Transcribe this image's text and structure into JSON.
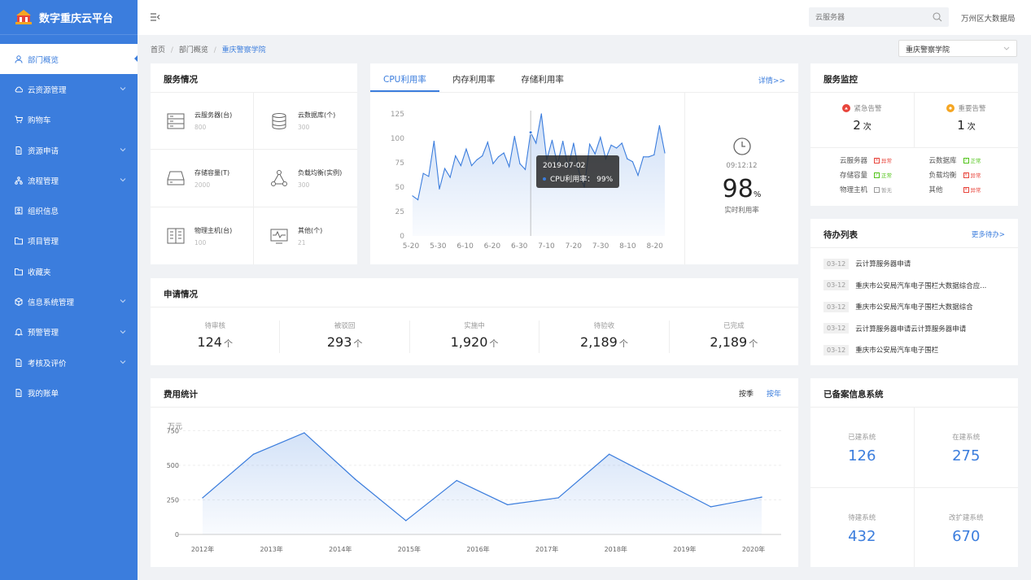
{
  "app": {
    "title": "数字重庆云平台"
  },
  "sidebar": {
    "items": [
      {
        "label": "部门概览",
        "icon": "user-icon",
        "active": true
      },
      {
        "label": "云资源管理",
        "icon": "cloud-icon",
        "expandable": true
      },
      {
        "label": "购物车",
        "icon": "cart-icon"
      },
      {
        "label": "资源申请",
        "icon": "document-icon",
        "expandable": true
      },
      {
        "label": "流程管理",
        "icon": "flow-icon",
        "expandable": true
      },
      {
        "label": "组织信息",
        "icon": "id-card-icon"
      },
      {
        "label": "项目管理",
        "icon": "folder-icon"
      },
      {
        "label": "收藏夹",
        "icon": "folder-icon"
      },
      {
        "label": "信息系统管理",
        "icon": "cube-icon",
        "expandable": true
      },
      {
        "label": "预警管理",
        "icon": "bell-icon",
        "expandable": true
      },
      {
        "label": "考核及评价",
        "icon": "document-icon",
        "expandable": true
      },
      {
        "label": "我的账单",
        "icon": "document-icon"
      }
    ]
  },
  "header": {
    "search_placeholder": "云服务器",
    "user": "万州区大数据局"
  },
  "breadcrumb": {
    "items": [
      "首页",
      "部门概览"
    ],
    "current": "重庆警察学院",
    "separator": "/"
  },
  "dept_select": {
    "value": "重庆警察学院"
  },
  "service_status": {
    "title": "服务情况",
    "items": [
      {
        "label": "云服务器(台)",
        "value": "800",
        "icon": "server-icon"
      },
      {
        "label": "云数据库(个)",
        "value": "300",
        "icon": "database-icon"
      },
      {
        "label": "存储容量(T)",
        "value": "2000",
        "icon": "storage-icon"
      },
      {
        "label": "负载均衡(实例)",
        "value": "300",
        "icon": "load-balancer-icon"
      },
      {
        "label": "物理主机(台)",
        "value": "100",
        "icon": "physical-host-icon"
      },
      {
        "label": "其他(个)",
        "value": "21",
        "icon": "monitor-icon"
      }
    ]
  },
  "utilization": {
    "tabs": [
      "CPU利用率",
      "内存利用率",
      "存储利用率"
    ],
    "active_tab": 0,
    "details_link": "详情>>",
    "tooltip_date": "2019-07-02",
    "tooltip_label": "CPU利用率：",
    "tooltip_value": "99%",
    "time": "09:12:12",
    "realtime_value": "98",
    "realtime_unit": "%",
    "realtime_label": "实时利用率"
  },
  "applications": {
    "title": "申请情况",
    "items": [
      {
        "label": "待审核",
        "value": "124"
      },
      {
        "label": "被驳回",
        "value": "293"
      },
      {
        "label": "实施中",
        "value": "1,920"
      },
      {
        "label": "待验收",
        "value": "2,189"
      },
      {
        "label": "已完成",
        "value": "2,189"
      }
    ],
    "trend_glyph": "个"
  },
  "cost": {
    "title": "费用统计",
    "toggle": [
      "按季",
      "按年"
    ],
    "active_toggle": 1,
    "unit": "万元"
  },
  "monitoring": {
    "title": "服务监控",
    "alerts": [
      {
        "label": "紧急告警",
        "value": "2",
        "unit": "次",
        "color": "#e8453c"
      },
      {
        "label": "重要告警",
        "value": "1",
        "unit": "次",
        "color": "#f5a623"
      }
    ],
    "items": [
      {
        "name": "云服务器",
        "status": "异常",
        "color": "#e8453c"
      },
      {
        "name": "云数据库",
        "status": "正常",
        "color": "#52c41a"
      },
      {
        "name": "存储容量",
        "status": "正常",
        "color": "#52c41a"
      },
      {
        "name": "负载均衡",
        "status": "异常",
        "color": "#e8453c"
      },
      {
        "name": "物理主机",
        "status": "暂无",
        "color": "#999999"
      },
      {
        "name": "其他",
        "status": "异常",
        "color": "#e8453c"
      }
    ]
  },
  "todo": {
    "title": "待办列表",
    "more": "更多待办>",
    "items": [
      {
        "date": "03-12",
        "text": "云计算服务器申请"
      },
      {
        "date": "03-12",
        "text": "重庆市公安局汽车电子围栏大数据综合应..."
      },
      {
        "date": "03-12",
        "text": "重庆市公安局汽车电子围栏大数据综合"
      },
      {
        "date": "03-12",
        "text": "云计算服务器申请云计算服务器申请"
      },
      {
        "date": "03-12",
        "text": "重庆市公安局汽车电子围栏"
      }
    ]
  },
  "systems": {
    "title": "已备案信息系统",
    "items": [
      {
        "label": "已建系统",
        "value": "126"
      },
      {
        "label": "在建系统",
        "value": "275"
      },
      {
        "label": "待建系统",
        "value": "432"
      },
      {
        "label": "改扩建系统",
        "value": "670"
      }
    ]
  },
  "colors": {
    "accent": "#3b7ddd",
    "sidebar": "#3b7ddd",
    "danger": "#e8453c",
    "warning": "#f5a623",
    "success": "#52c41a"
  },
  "chart_data": [
    {
      "type": "area",
      "title": "CPU利用率",
      "categories": [
        "5-20",
        "5-30",
        "6-10",
        "6-20",
        "6-30",
        "7-10",
        "7-20",
        "7-30",
        "8-10",
        "8-20"
      ],
      "yticks": [
        0,
        25,
        50,
        75,
        100,
        125
      ],
      "ylim": [
        0,
        125
      ],
      "xlim": [
        0,
        48
      ],
      "series": [
        {
          "values": [
            41,
            37,
            64,
            61,
            97,
            48,
            69,
            60,
            82,
            72,
            89,
            72,
            78,
            82,
            96,
            74,
            81,
            85,
            71,
            102,
            74,
            68,
            106,
            95,
            125,
            78,
            98,
            73,
            97,
            70,
            95,
            66,
            50,
            94,
            84,
            101,
            79,
            93,
            90,
            95,
            79,
            76,
            62,
            81,
            81,
            83,
            113,
            85
          ]
        }
      ],
      "highlight_index": 22
    },
    {
      "type": "area",
      "title": "费用统计",
      "ylabel": "万元",
      "categories": [
        "2012年",
        "2013年",
        "2014年",
        "2015年",
        "2016年",
        "2017年",
        "2018年",
        "2019年",
        "2020年"
      ],
      "yticks": [
        0,
        250,
        500,
        750
      ],
      "ylim": [
        0,
        800
      ],
      "series": [
        {
          "values": [
            265,
            580,
            735,
            400,
            100,
            390,
            215,
            265,
            580,
            390,
            200,
            270
          ]
        }
      ]
    }
  ]
}
